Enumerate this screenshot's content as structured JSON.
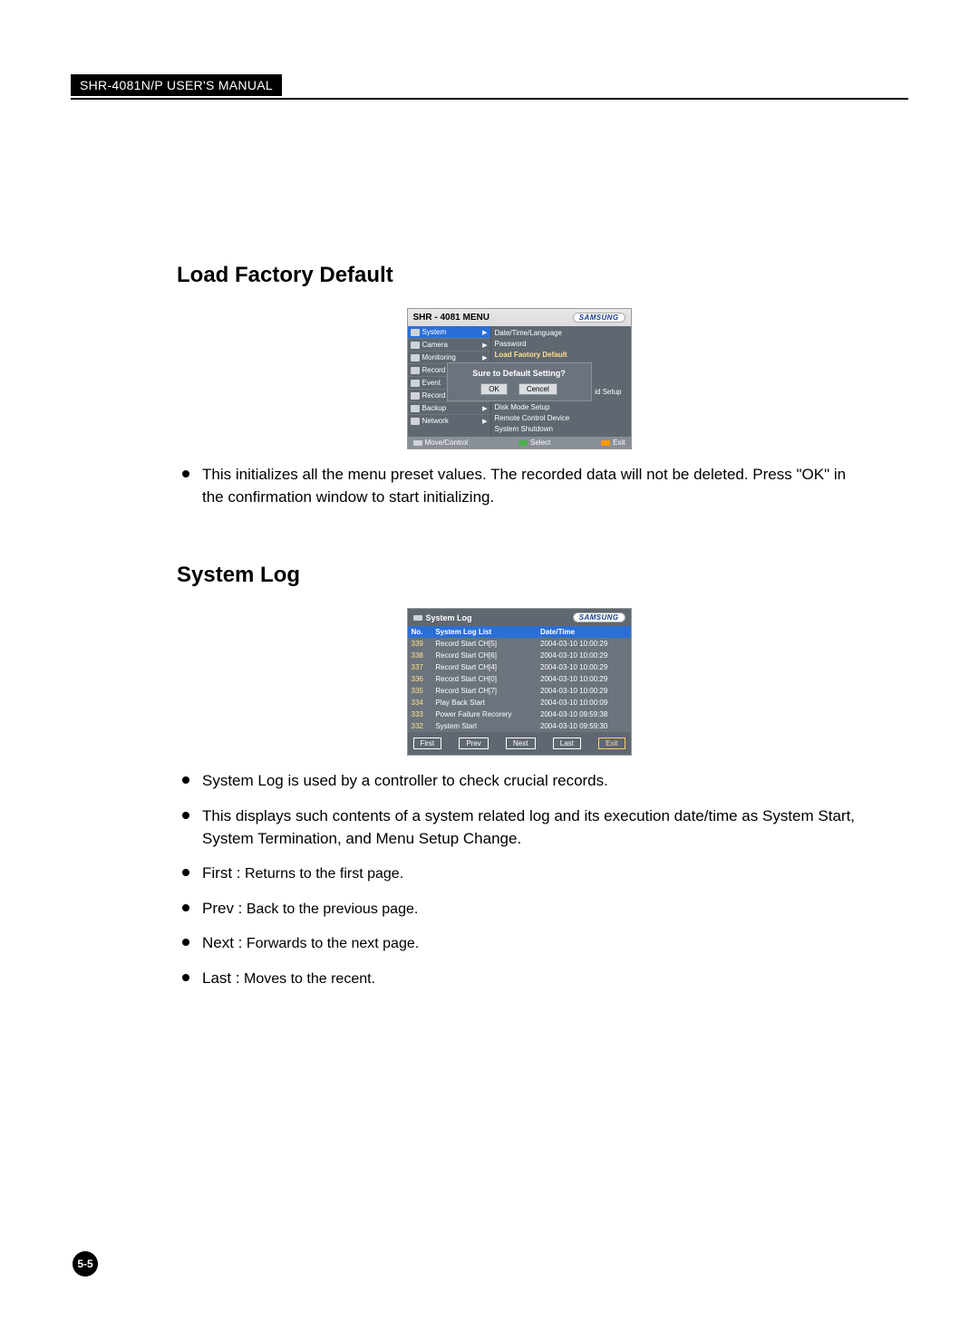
{
  "header": {
    "title": "SHR-4081N/P USER'S MANUAL"
  },
  "section1": {
    "heading": "Load Factory Default",
    "menu_title": "SHR - 4081 MENU",
    "brand": "SAMSUNG",
    "left_menu": [
      "System",
      "Camera",
      "Monitoring",
      "Record",
      "Event",
      "Record Schedule",
      "Backup",
      "Network"
    ],
    "right_menu": [
      "Date/Time/Language",
      "Password",
      "Load Faotory Default"
    ],
    "right_menu_hidden_side": "id Setup",
    "right_menu_bottom": [
      "Disk Mode Setup",
      "Remote Control Device",
      "System Shutdown"
    ],
    "modal_q": "Sure to Default Setting?",
    "modal_ok": "OK",
    "modal_cancel": "Cencel",
    "footer": {
      "move": "Move/Control",
      "select": "Select",
      "exit": "Exit"
    },
    "bullets": [
      "This initializes all the menu preset values.\nThe recorded data will not be deleted. Press \"OK\" in the confirmation window to start initializing."
    ]
  },
  "section2": {
    "heading": "System Log",
    "panel_title": "System Log",
    "brand": "SAMSUNG",
    "cols": {
      "no": "No.",
      "list": "System Log List",
      "dt": "Date/Time"
    },
    "rows": [
      {
        "no": "339",
        "list": "Record Start CH[5]",
        "dt": "2004-03-10 10:00:29"
      },
      {
        "no": "338",
        "list": "Record Start CH[6]",
        "dt": "2004-03-10 10:00:29"
      },
      {
        "no": "337",
        "list": "Record Start CH[4]",
        "dt": "2004-03-10 10:00:29"
      },
      {
        "no": "336",
        "list": "Record Start CH[0]",
        "dt": "2004-03-10 10:00:29"
      },
      {
        "no": "335",
        "list": "Record Start CH[7]",
        "dt": "2004-03-10 10:00:29"
      },
      {
        "no": "334",
        "list": "Play Back Start",
        "dt": "2004-03-10 10:00:09"
      },
      {
        "no": "333",
        "list": "Power Failure Recorery",
        "dt": "2004-03-10 09:59:38"
      },
      {
        "no": "332",
        "list": "System Start",
        "dt": "2004-03-10 09:59:30"
      }
    ],
    "buttons": {
      "first": "First",
      "prev": "Prev",
      "next": "Next",
      "last": "Last",
      "exit": "Exit"
    },
    "bullets": [
      {
        "pre": "",
        "text": "System Log is used by a controller to check crucial records."
      },
      {
        "pre": "",
        "text": "This displays such contents of a system related log and its execution date/time as System Start, System Termination, and Menu Setup Change."
      },
      {
        "pre": "First :",
        "text": " Returns to the first page."
      },
      {
        "pre": "Prev  :",
        "text": " Back to the previous page."
      },
      {
        "pre": "Next  :",
        "text": " Forwards to the next page."
      },
      {
        "pre": "Last  :",
        "text": " Moves to the recent."
      }
    ]
  },
  "page_number": "5-5"
}
